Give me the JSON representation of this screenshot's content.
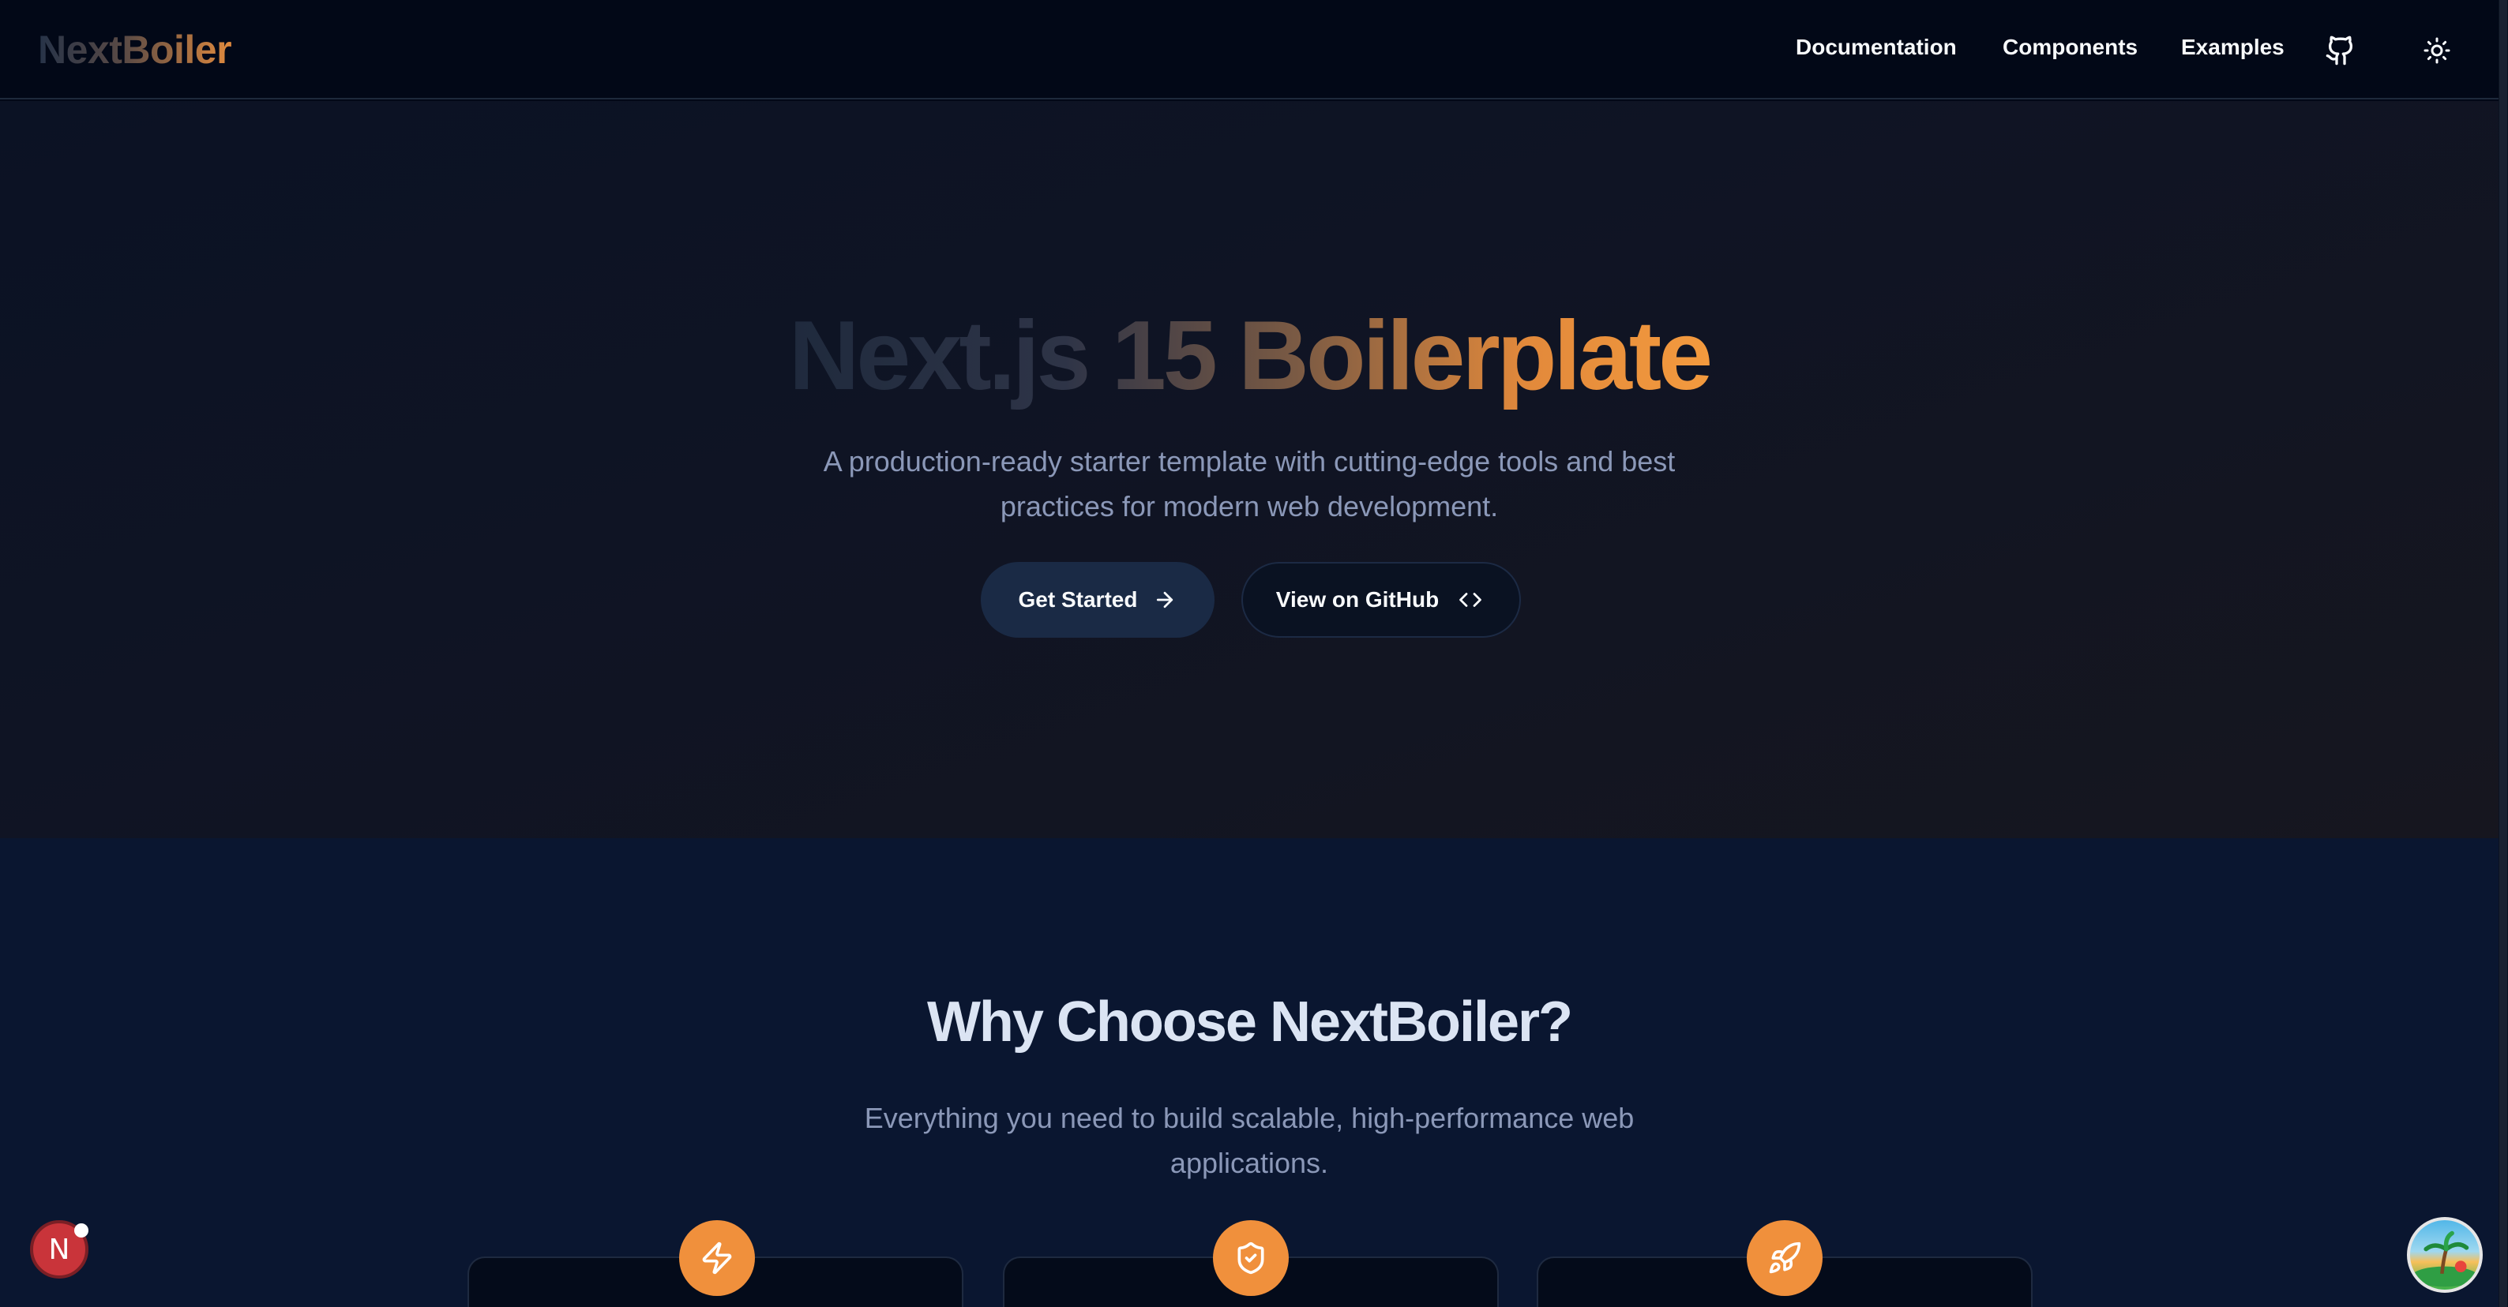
{
  "header": {
    "logo": "NextBoiler",
    "nav": [
      {
        "label": "Documentation"
      },
      {
        "label": "Components"
      },
      {
        "label": "Examples"
      }
    ],
    "icons": {
      "github": "github-icon",
      "theme": "sun-icon"
    }
  },
  "hero": {
    "title": "Next.js 15 Boilerplate",
    "subtitle": "A production-ready starter template with cutting-edge tools and best practices for modern web development.",
    "primary_button": "Get Started",
    "secondary_button": "View on GitHub",
    "primary_icon": "arrow-right-icon",
    "secondary_icon": "code-icon"
  },
  "features": {
    "title": "Why Choose NextBoiler?",
    "subtitle": "Everything you need to build scalable, high-performance web applications.",
    "cards": [
      {
        "icon": "lightning-icon"
      },
      {
        "icon": "shield-check-icon"
      },
      {
        "icon": "rocket-icon"
      }
    ]
  },
  "widgets": {
    "next_badge": "N",
    "avatar": "avatar"
  },
  "colors": {
    "background": "#020817",
    "accent": "#f0903c",
    "primary_button_bg": "#1a2a45",
    "muted_text": "#8b98b8"
  }
}
